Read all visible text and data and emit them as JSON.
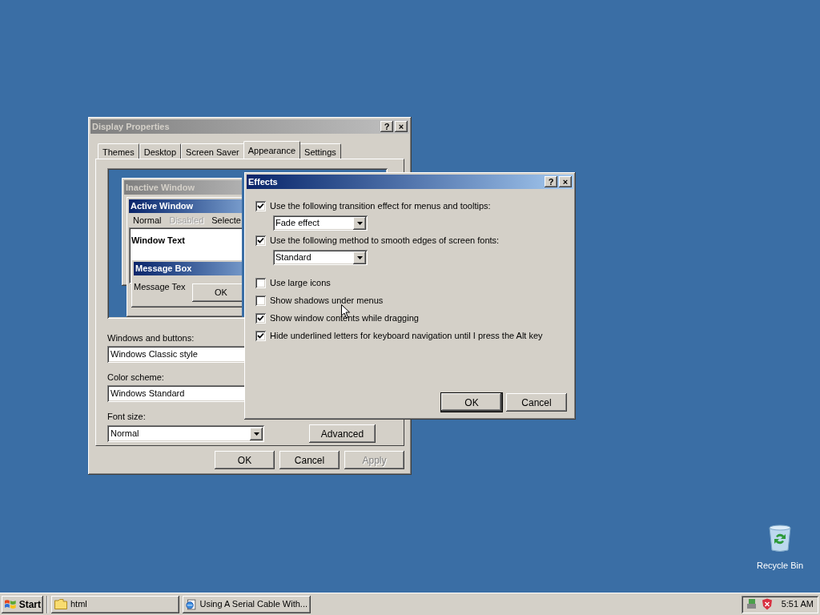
{
  "desktop": {
    "icons": [
      {
        "label": "Recycle Bin"
      }
    ]
  },
  "display_properties": {
    "title": "Display Properties",
    "title_buttons": [
      "?",
      "×"
    ],
    "tabs": [
      {
        "label": "Themes",
        "selected": false
      },
      {
        "label": "Desktop",
        "selected": false
      },
      {
        "label": "Screen Saver",
        "selected": false
      },
      {
        "label": "Appearance",
        "selected": true
      },
      {
        "label": "Settings",
        "selected": false
      }
    ],
    "preview": {
      "inactive_title": "Inactive Window",
      "active_title": "Active Window",
      "menu": [
        {
          "label": "Normal",
          "disabled": false
        },
        {
          "label": "Disabled",
          "disabled": true
        },
        {
          "label": "Selecte",
          "disabled": false
        }
      ],
      "window_text": "Window Text",
      "message_box_title": "Message Box",
      "message_text": "Message Tex",
      "ok": "OK"
    },
    "fields": [
      {
        "label": "Windows and buttons:",
        "value": "Windows Classic style"
      },
      {
        "label": "Color scheme:",
        "value": "Windows Standard"
      },
      {
        "label": "Font size:",
        "value": "Normal"
      }
    ],
    "advanced": "Advanced",
    "buttons": [
      {
        "label": "OK",
        "disabled": false
      },
      {
        "label": "Cancel",
        "disabled": false
      },
      {
        "label": "Apply",
        "disabled": true
      }
    ]
  },
  "effects": {
    "title": "Effects",
    "title_buttons": [
      "?",
      "×"
    ],
    "options": [
      {
        "label": "Use the following transition effect for menus and tooltips:",
        "checked": true,
        "dropdown": "Fade effect"
      },
      {
        "label": "Use the following method to smooth edges of screen fonts:",
        "checked": true,
        "dropdown": "Standard"
      },
      {
        "label": "Use large icons",
        "checked": false
      },
      {
        "label": "Show shadows under menus",
        "checked": false
      },
      {
        "label": "Show window contents while dragging",
        "checked": true
      },
      {
        "label": "Hide underlined letters for keyboard navigation until I press the Alt key",
        "checked": true
      }
    ],
    "buttons": [
      {
        "label": "OK",
        "default": true
      },
      {
        "label": "Cancel",
        "default": false
      }
    ]
  },
  "taskbar": {
    "start": "Start",
    "tasks": [
      {
        "label": "html",
        "kind": "folder"
      },
      {
        "label": "Using A Serial Cable With...",
        "kind": "browser"
      }
    ],
    "clock": "5:51 AM"
  }
}
